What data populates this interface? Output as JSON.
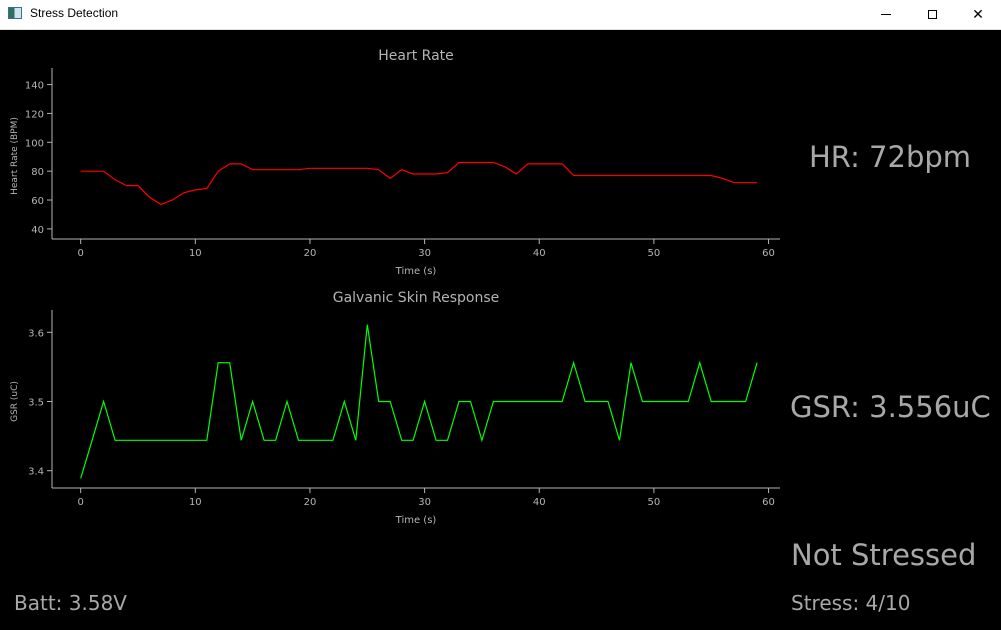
{
  "window": {
    "title": "Stress Detection"
  },
  "readouts": {
    "hr": "HR: 72bpm",
    "gsr": "GSR: 3.556uC",
    "state": "Not Stressed",
    "stress": "Stress: 4/10",
    "battery": "Batt: 3.58V"
  },
  "chart_data": [
    {
      "type": "line",
      "title": "Heart Rate",
      "xlabel": "Time (s)",
      "ylabel": "Heart Rate (BPM)",
      "xlim": [
        -2.5,
        61
      ],
      "ylim": [
        33,
        148
      ],
      "xticks": [
        0,
        10,
        20,
        30,
        40,
        50,
        60
      ],
      "yticks": [
        40,
        60,
        80,
        100,
        120,
        140
      ],
      "color": "#ff0000",
      "grid": false,
      "x": [
        0,
        1,
        2,
        3,
        4,
        5,
        6,
        7,
        8,
        9,
        10,
        11,
        12,
        13,
        14,
        15,
        16,
        17,
        18,
        19,
        20,
        21,
        22,
        23,
        24,
        25,
        26,
        27,
        28,
        29,
        30,
        31,
        32,
        33,
        34,
        35,
        36,
        37,
        38,
        39,
        40,
        41,
        42,
        43,
        44,
        45,
        46,
        47,
        48,
        49,
        50,
        51,
        52,
        53,
        54,
        55,
        56,
        57,
        58,
        59
      ],
      "y": [
        80,
        80,
        80,
        74,
        70,
        70,
        62,
        57,
        60,
        65,
        67,
        68,
        80,
        85,
        85,
        81,
        81,
        81,
        81,
        81,
        82,
        82,
        82,
        82,
        82,
        82,
        81,
        75,
        81,
        78,
        78,
        78,
        79,
        86,
        86,
        86,
        86,
        83,
        78,
        85,
        85,
        85,
        85,
        77,
        77,
        77,
        77,
        77,
        77,
        77,
        77,
        77,
        77,
        77,
        77,
        77,
        75,
        72,
        72,
        72
      ]
    },
    {
      "type": "line",
      "title": "Galvanic Skin Response",
      "xlabel": "Time (s)",
      "ylabel": "GSR (uC)",
      "xlim": [
        -2.5,
        61
      ],
      "ylim": [
        3.375,
        3.625
      ],
      "xticks": [
        0,
        10,
        20,
        30,
        40,
        50,
        60
      ],
      "yticks": [
        3.4,
        3.5,
        3.6
      ],
      "color": "#00ff00",
      "grid": false,
      "x": [
        0,
        1,
        2,
        3,
        4,
        5,
        6,
        7,
        8,
        9,
        10,
        11,
        12,
        13,
        14,
        15,
        16,
        17,
        18,
        19,
        20,
        21,
        22,
        23,
        24,
        25,
        26,
        27,
        28,
        29,
        30,
        31,
        32,
        33,
        34,
        35,
        36,
        37,
        38,
        39,
        40,
        41,
        42,
        43,
        44,
        45,
        46,
        47,
        48,
        49,
        50,
        51,
        52,
        53,
        54,
        55,
        56,
        57,
        58,
        59
      ],
      "y": [
        3.389,
        3.444,
        3.5,
        3.444,
        3.444,
        3.444,
        3.444,
        3.444,
        3.444,
        3.444,
        3.444,
        3.444,
        3.556,
        3.556,
        3.444,
        3.5,
        3.444,
        3.444,
        3.5,
        3.444,
        3.444,
        3.444,
        3.444,
        3.5,
        3.444,
        3.611,
        3.5,
        3.5,
        3.444,
        3.444,
        3.5,
        3.444,
        3.444,
        3.5,
        3.5,
        3.444,
        3.5,
        3.5,
        3.5,
        3.5,
        3.5,
        3.5,
        3.5,
        3.556,
        3.5,
        3.5,
        3.5,
        3.444,
        3.556,
        3.5,
        3.5,
        3.5,
        3.5,
        3.5,
        3.556,
        3.5,
        3.5,
        3.5,
        3.5,
        3.556
      ]
    }
  ]
}
